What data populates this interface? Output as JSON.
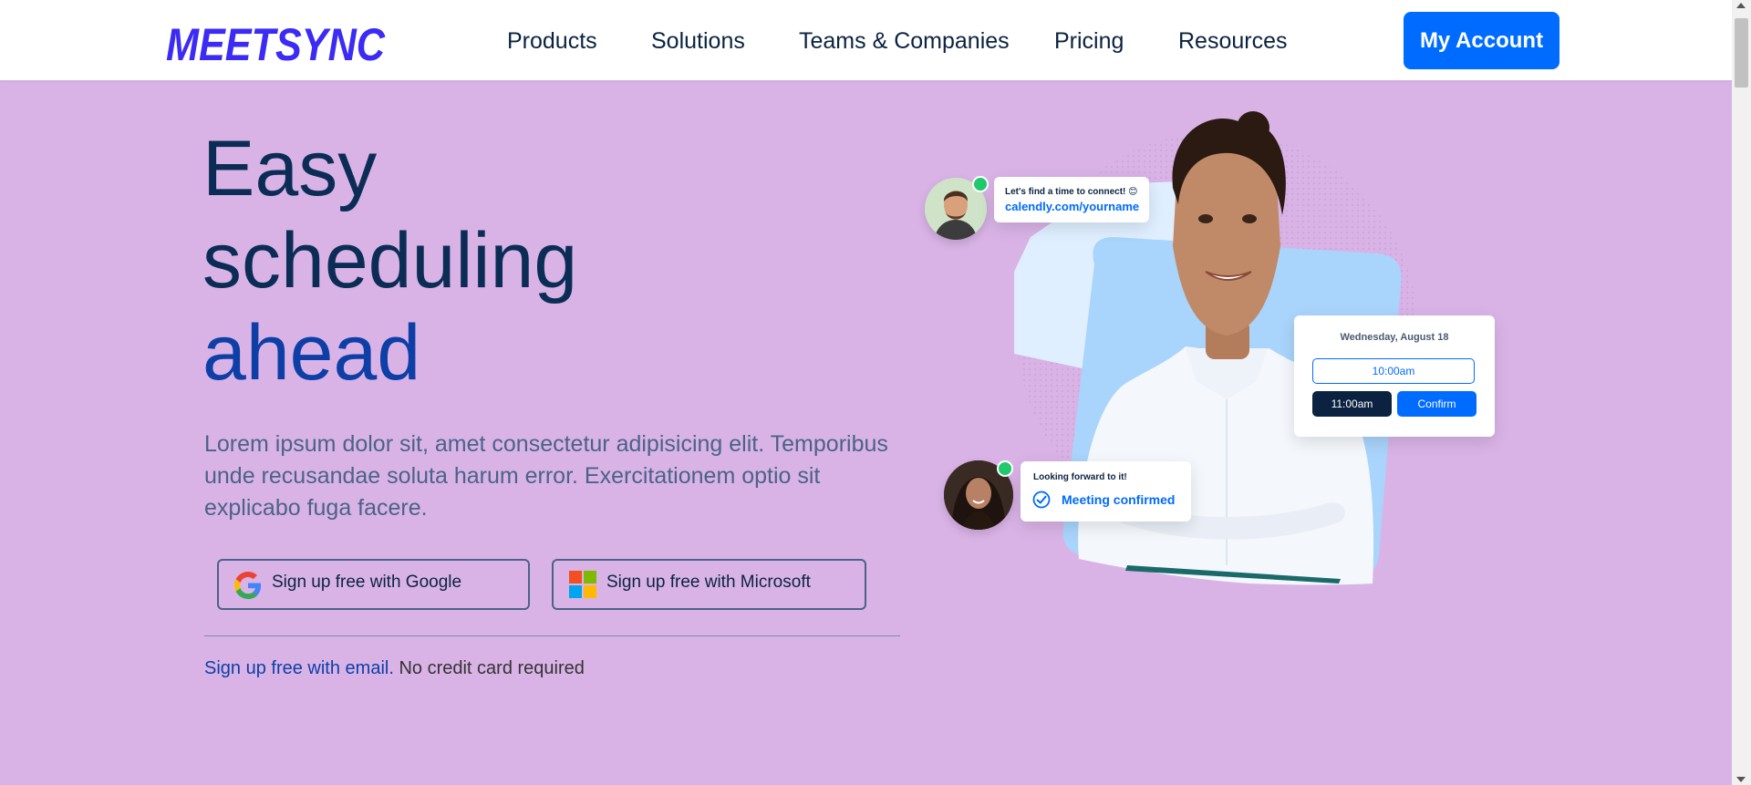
{
  "brand": {
    "logo_text": "MEETSYNC",
    "accent_color": "#3b2bf5"
  },
  "nav": {
    "items": [
      "Products",
      "Solutions",
      "Teams & Companies",
      "Pricing",
      "Resources"
    ],
    "account_label": "My Account",
    "account_color": "#006bff"
  },
  "hero": {
    "title_line1": "Easy",
    "title_line2": "scheduling",
    "title_line3": "ahead",
    "description": "Lorem ipsum dolor sit, amet consectetur adipisicing elit. Temporibus unde recusandae soluta harum error. Exercitationem optio sit explicabo fuga facere.",
    "google_label": "Sign up free with Google",
    "microsoft_label": "Sign up free with Microsoft",
    "email_link": "Sign up free with email.",
    "no_card_text": "No credit card required",
    "background_color": "#d9b3e6"
  },
  "illustration": {
    "chat1_text": "Let's find a time to connect! 😊",
    "chat1_link": "calendly.com/yourname",
    "date_label": "Wednesday, August 18",
    "slot1": "10:00am",
    "slot2": "11:00am",
    "confirm_label": "Confirm",
    "chat2_text": "Looking forward to it!",
    "chat2_status": "Meeting confirmed"
  }
}
